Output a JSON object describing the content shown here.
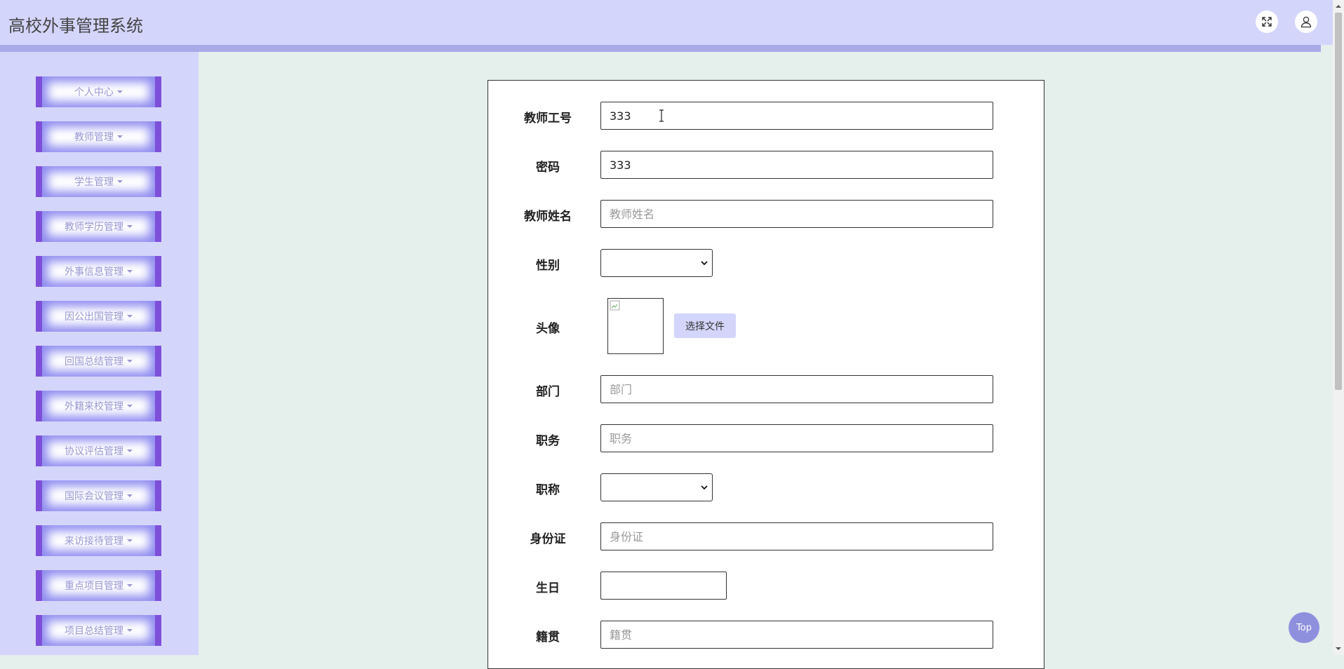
{
  "header": {
    "title": "高校外事管理系统",
    "fullscreen_icon": "fullscreen-icon",
    "user_icon": "user-icon"
  },
  "sidebar": {
    "items": [
      {
        "label": "个人中心"
      },
      {
        "label": "教师管理"
      },
      {
        "label": "学生管理"
      },
      {
        "label": "教师学历管理"
      },
      {
        "label": "外事信息管理"
      },
      {
        "label": "因公出国管理"
      },
      {
        "label": "回国总结管理"
      },
      {
        "label": "外籍来校管理"
      },
      {
        "label": "协议评估管理"
      },
      {
        "label": "国际会议管理"
      },
      {
        "label": "来访接待管理"
      },
      {
        "label": "重点项目管理"
      },
      {
        "label": "项目总结管理"
      }
    ]
  },
  "form": {
    "teacher_id": {
      "label": "教师工号",
      "value": "333"
    },
    "password": {
      "label": "密码",
      "value": "333"
    },
    "teacher_name": {
      "label": "教师姓名",
      "placeholder": "教师姓名"
    },
    "gender": {
      "label": "性别",
      "value": ""
    },
    "avatar": {
      "label": "头像",
      "button": "选择文件"
    },
    "department": {
      "label": "部门",
      "placeholder": "部门"
    },
    "position": {
      "label": "职务",
      "placeholder": "职务"
    },
    "title": {
      "label": "职称",
      "value": ""
    },
    "id_card": {
      "label": "身份证",
      "placeholder": "身份证"
    },
    "birthday": {
      "label": "生日",
      "value": ""
    },
    "native_place": {
      "label": "籍贯",
      "placeholder": "籍贯"
    }
  },
  "top_button": {
    "label": "Top"
  },
  "colors": {
    "header_bg": "#d4d5fb",
    "sidebar_bg": "#d4d5fb",
    "content_bg": "#e5efec",
    "menu_accent": "#7e50d9",
    "menu_text": "#9a98d2",
    "top_button": "#8e90dd"
  }
}
